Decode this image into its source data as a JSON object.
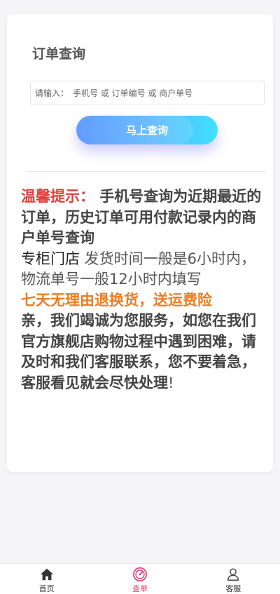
{
  "card": {
    "title": "订单查询",
    "search": {
      "prefix": "请输入：",
      "placeholder": "手机号 或 订单编号 或 商户单号"
    },
    "query_button": "马上查询"
  },
  "notice": {
    "lead_red": "温馨提示：",
    "p1": "手机号查询为近期最近的订单，历史订单可用付款记录内的商户单号查询",
    "p2_dark": "专柜门店",
    "p2_rest": " 发货时间一般是6小时内，物流单号一般12小时内填写",
    "p3_orange": "七天无理由退换货，送运费险",
    "p4": "亲，我们竭诚为您服务，如您在我们官方旗舰店购物过程中遇到困难，请及时和我们客服联系，您不要着急，客服看见就会尽快处理",
    "p4_end": "!"
  },
  "tabbar": {
    "items": [
      {
        "label": "首页",
        "icon": "home-icon",
        "active": false
      },
      {
        "label": "查单",
        "icon": "order-query-icon",
        "active": true
      },
      {
        "label": "客服",
        "icon": "customer-service-icon",
        "active": false
      }
    ],
    "active_color": "#e83c6a"
  }
}
